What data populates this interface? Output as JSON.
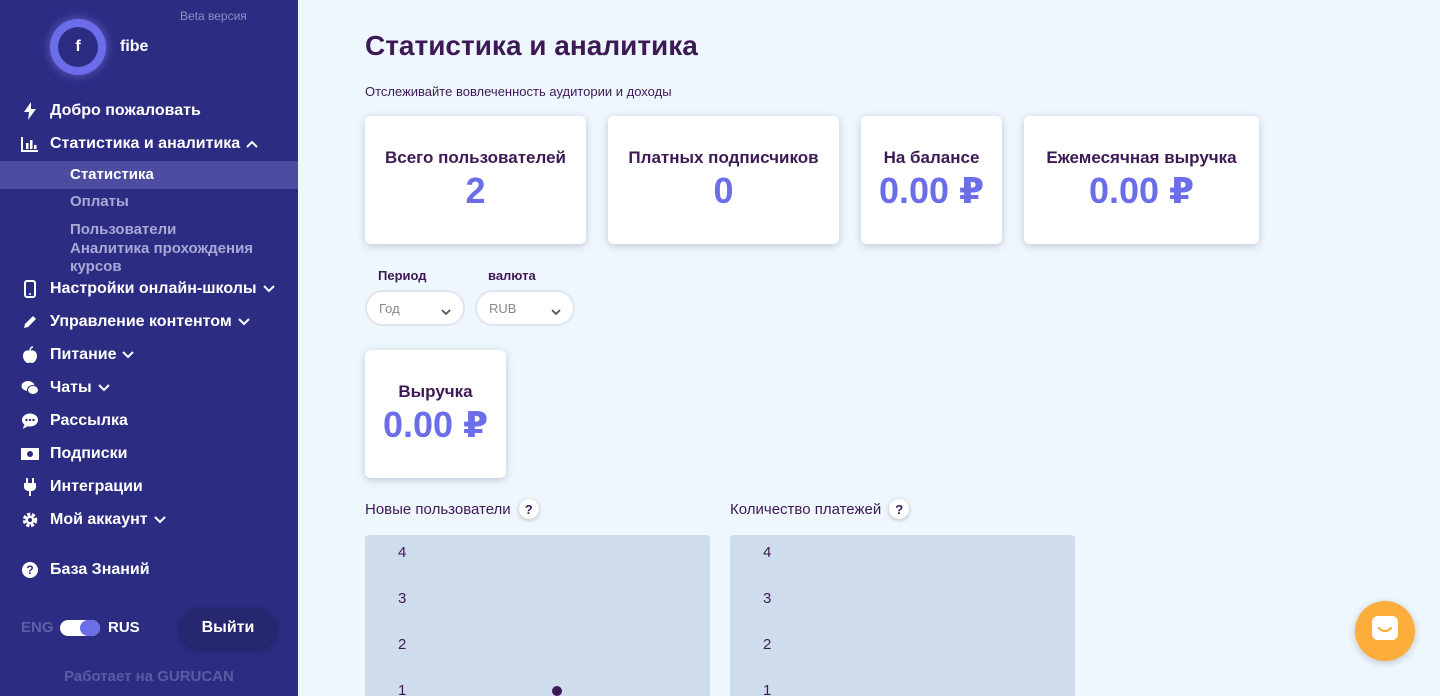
{
  "sidebar": {
    "beta": "Beta версия",
    "avatar_letter": "f",
    "username": "fibe",
    "items": [
      {
        "label": "Добро пожаловать",
        "icon": "bolt-icon"
      },
      {
        "label": "Статистика и аналитика",
        "icon": "bar-chart-icon",
        "expanded": true
      },
      {
        "label": "Настройки онлайн-школы",
        "icon": "phone-icon",
        "has_chevron": true
      },
      {
        "label": "Управление контентом",
        "icon": "pencil-icon",
        "has_chevron": true
      },
      {
        "label": "Питание",
        "icon": "apple-icon",
        "has_chevron": true
      },
      {
        "label": "Чаты",
        "icon": "chat-bubbles-icon",
        "has_chevron": true
      },
      {
        "label": "Рассылка",
        "icon": "message-icon"
      },
      {
        "label": "Подписки",
        "icon": "money-icon"
      },
      {
        "label": "Интеграции",
        "icon": "plug-icon"
      },
      {
        "label": "Мой аккаунт",
        "icon": "gear-icon",
        "has_chevron": true
      },
      {
        "label": "База Знаний",
        "icon": "question-circle-icon"
      }
    ],
    "subitems": [
      {
        "label": "Статистика",
        "active": true
      },
      {
        "label": "Оплаты"
      },
      {
        "label": "Пользователи"
      },
      {
        "label": "Аналитика прохождения курсов"
      }
    ],
    "lang_eng": "ENG",
    "lang_rus": "RUS",
    "logout": "Выйти",
    "powered": "Работает на GURUCAN"
  },
  "main": {
    "title": "Статистика и аналитика",
    "subtitle": "Отслеживайте вовлеченность аудитории и доходы",
    "cards": [
      {
        "label": "Всего пользователей",
        "value": "2"
      },
      {
        "label": "Платных подписчиков",
        "value": "0"
      },
      {
        "label": "На балансе",
        "value": "0.00 ₽"
      },
      {
        "label": "Ежемесячная выручка",
        "value": "0.00 ₽"
      }
    ],
    "filters": {
      "period_label": "Период",
      "period_value": "Год",
      "currency_label": "валюта",
      "currency_value": "RUB"
    },
    "revenue_card": {
      "label": "Выручка",
      "value": "0.00 ₽"
    },
    "charts": [
      {
        "label": "Новые пользователи",
        "help": "?"
      },
      {
        "label": "Количество платежей",
        "help": "?"
      }
    ]
  },
  "chart_data": [
    {
      "type": "scatter",
      "title": "Новые пользователи",
      "y_ticks": [
        "4",
        "3",
        "2",
        "1"
      ],
      "points": [
        {
          "y": 1
        }
      ]
    },
    {
      "type": "scatter",
      "title": "Количество платежей",
      "y_ticks": [
        "4",
        "3",
        "2",
        "1"
      ],
      "points": []
    }
  ],
  "colors": {
    "sidebar": "#2d2c83",
    "accent": "#6b6ee8",
    "text": "#3d1a55",
    "background": "#eef7fd",
    "chat": "#fdad3c"
  }
}
